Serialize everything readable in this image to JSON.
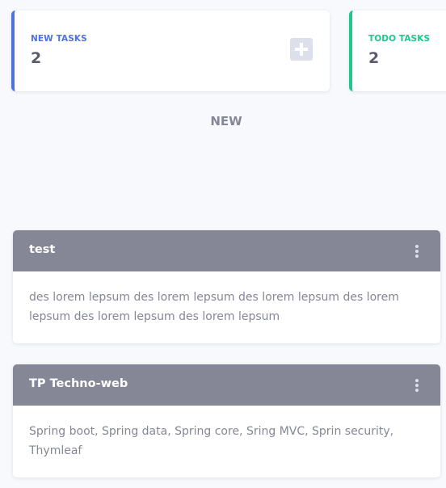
{
  "stats": [
    {
      "label": "NEW TASKS",
      "count": "2",
      "accent": "#4e73df"
    },
    {
      "label": "TODO TASKS",
      "count": "2",
      "accent": "#1cc88a"
    }
  ],
  "add_icon": "plus-square-icon",
  "column": {
    "title": "NEW"
  },
  "tasks": [
    {
      "title": "test",
      "description": "des lorem lepsum des lorem lepsum des lorem lepsum des lorem lepsum des lorem lepsum des lorem lepsum",
      "menu_icon": "vertical-ellipsis-icon"
    },
    {
      "title": "TP Techno-web",
      "description": "Spring boot, Spring data, Spring core, Sring MVC, Sprin security, Thymleaf",
      "menu_icon": "vertical-ellipsis-icon"
    }
  ],
  "colors": {
    "background": "#f8f9fc",
    "card_header": "#858796",
    "text_muted": "#858796",
    "text_dark": "#5a5c69"
  }
}
